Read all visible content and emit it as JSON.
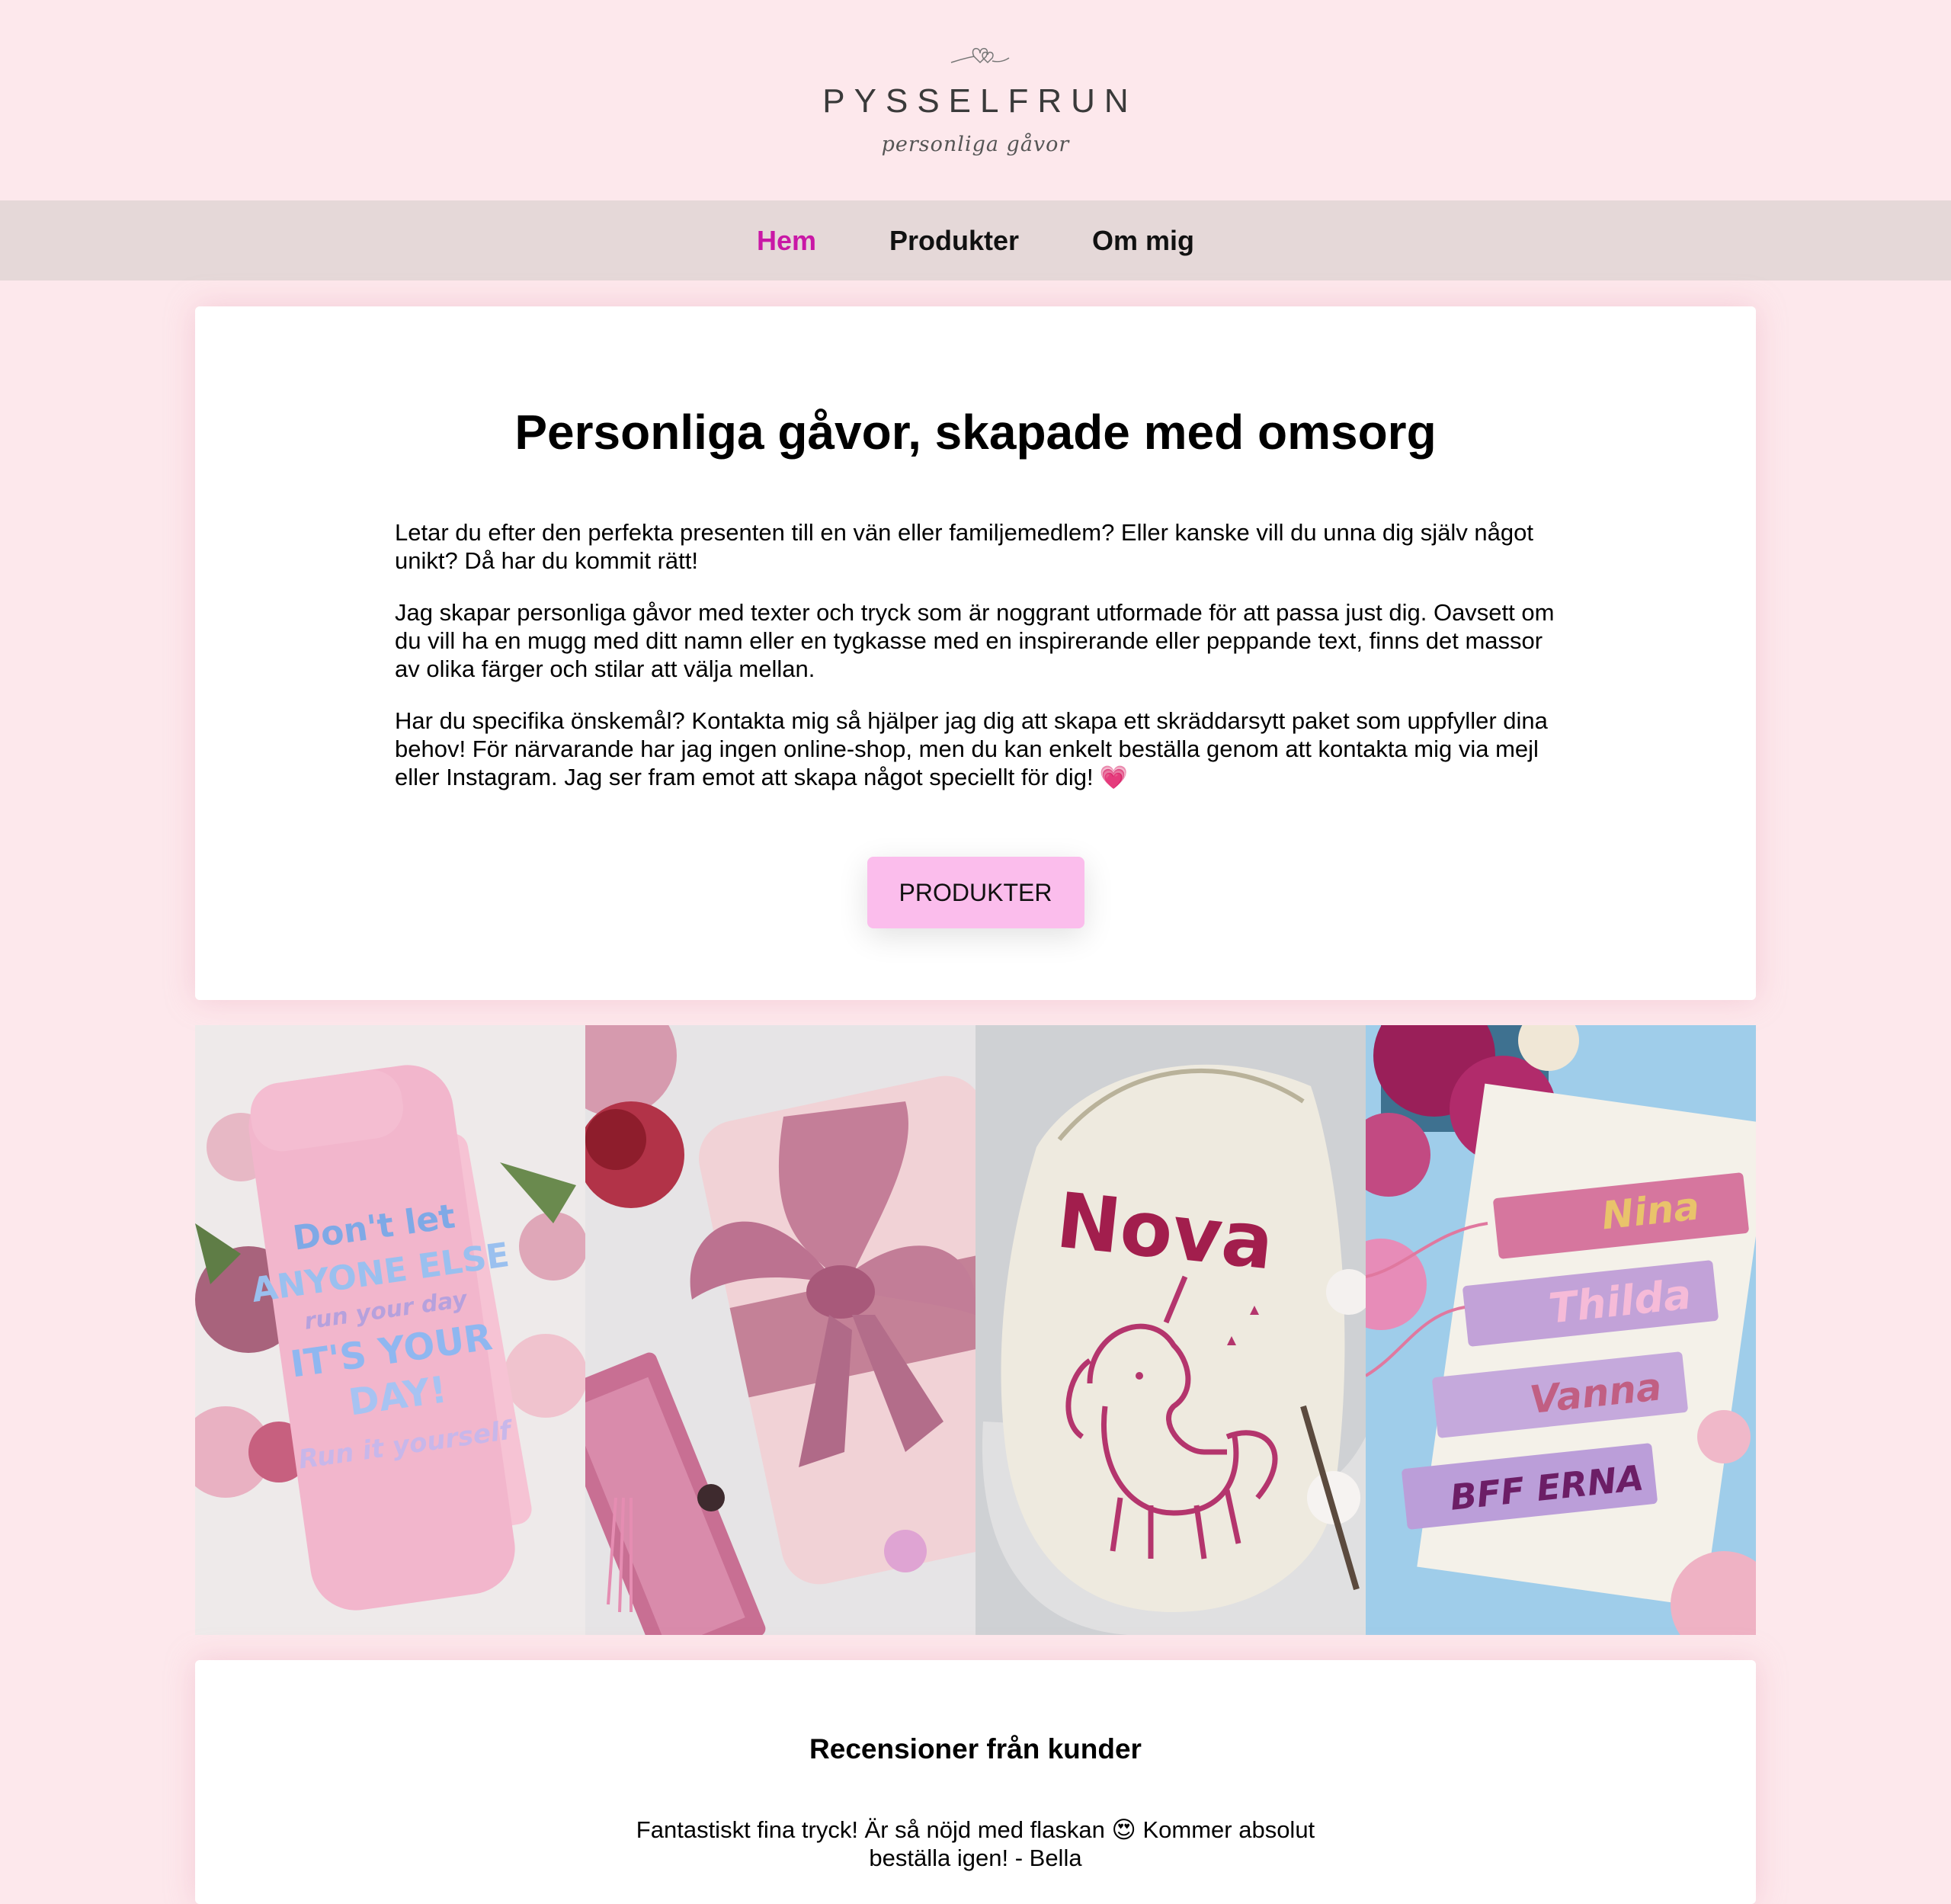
{
  "header": {
    "logo_title": "PYSSELFRUN",
    "logo_subtitle": "personliga gåvor"
  },
  "nav": {
    "items": [
      {
        "label": "Hem",
        "active": true
      },
      {
        "label": "Produkter",
        "active": false
      },
      {
        "label": "Om mig",
        "active": false
      }
    ]
  },
  "hero": {
    "title": "Personliga gåvor, skapade med omsorg",
    "paragraphs": [
      "Letar du efter den perfekta presenten till en vän eller familjemedlem? Eller kanske vill du unna dig själv något unikt? Då har du kommit rätt!",
      "Jag skapar personliga gåvor med texter och tryck som är noggrant utformade för att passa just dig. Oavsett om du vill ha en mugg med ditt namn eller en tygkasse med en inspirerande eller peppande text, finns det massor av olika färger och stilar att välja mellan.",
      "Har du specifika önskemål? Kontakta mig så hjälper jag dig att skapa ett skräddarsytt paket som uppfyller dina behov! För närvarande har jag ingen online-shop, men du kan enkelt beställa genom att kontakta mig via mejl eller Instagram. Jag ser fram emot att skapa något speciellt för dig!"
    ],
    "heart_glyph": "💗",
    "button_label": "PRODUKTER"
  },
  "gallery": {
    "photos": [
      {
        "name": "pink-bottle-photo",
        "text_lines": [
          "Don't let",
          "ANYONE ELSE",
          "run your day",
          "IT'S YOUR",
          "DAY!",
          "Run it yourself"
        ]
      },
      {
        "name": "gift-bow-photo"
      },
      {
        "name": "nova-bag-photo",
        "text": "Nova"
      },
      {
        "name": "bookmarks-photo",
        "names": [
          "Nina",
          "Thilda",
          "Vanna",
          "BFF ERNA"
        ]
      }
    ]
  },
  "reviews": {
    "title": "Recensioner från kunder",
    "text_before": "Fantastiskt fina tryck! Är så nöjd med flaskan",
    "emoji": "😍",
    "text_after": "Kommer absolut beställa igen! - Bella"
  },
  "colors": {
    "background": "#fde8ec",
    "nav_background": "#e5d8d8",
    "accent": "#c918a6",
    "button": "#fbbdec"
  }
}
